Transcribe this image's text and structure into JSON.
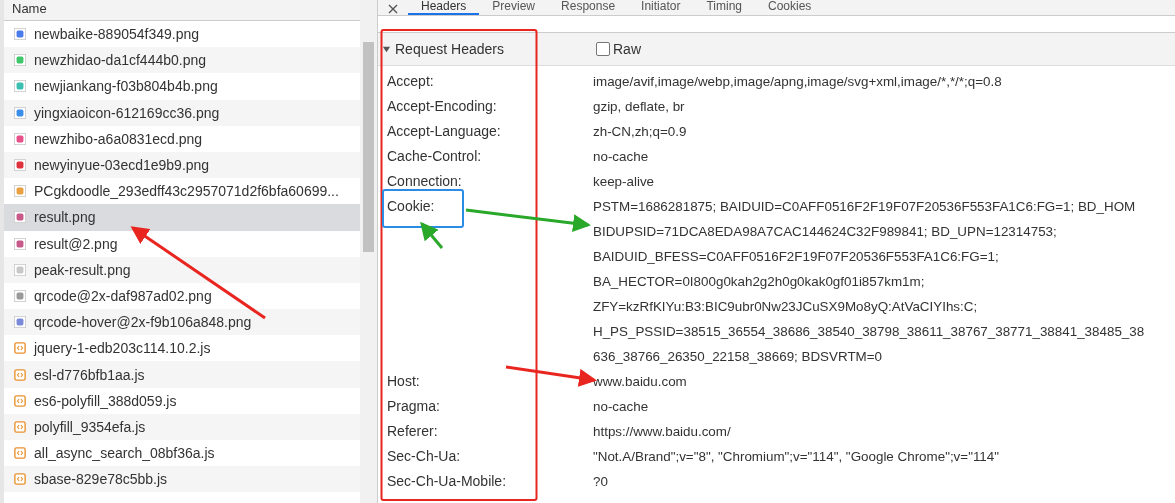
{
  "requests": {
    "column_header": "Name",
    "items": [
      {
        "name": "newbaike-889054f349.png",
        "kind": "image",
        "color": "#4a7bea",
        "selected": false
      },
      {
        "name": "newzhidao-da1cf444b0.png",
        "kind": "image",
        "color": "#3fc56b",
        "selected": false
      },
      {
        "name": "newjiankang-f03b804b4b.png",
        "kind": "image",
        "color": "#3bbfb0",
        "selected": false
      },
      {
        "name": "yingxiaoicon-612169cc36.png",
        "kind": "image",
        "color": "#3a8ee8",
        "selected": false
      },
      {
        "name": "newzhibo-a6a0831ecd.png",
        "kind": "image",
        "color": "#e8508a",
        "selected": false
      },
      {
        "name": "newyinyue-03ecd1e9b9.png",
        "kind": "image",
        "color": "#e0323c",
        "selected": false
      },
      {
        "name": "PCgkdoodle_293edff43c2957071d2f6bfa60699...",
        "kind": "image",
        "color": "#e8a040",
        "selected": false
      },
      {
        "name": "result.png",
        "kind": "image",
        "color": "#c85a8a",
        "selected": true
      },
      {
        "name": "result@2.png",
        "kind": "image",
        "color": "#c85a8a",
        "selected": false
      },
      {
        "name": "peak-result.png",
        "kind": "image",
        "color": "#c8c8c8",
        "selected": false
      },
      {
        "name": "qrcode@2x-daf987ad02.png",
        "kind": "image",
        "color": "#9a9a9a",
        "selected": false
      },
      {
        "name": "qrcode-hover@2x-f9b106a848.png",
        "kind": "image",
        "color": "#7a8ad8",
        "selected": false
      },
      {
        "name": "jquery-1-edb203c114.10.2.js",
        "kind": "script",
        "selected": false
      },
      {
        "name": "esl-d776bfb1aa.js",
        "kind": "script",
        "selected": false
      },
      {
        "name": "es6-polyfill_388d059.js",
        "kind": "script",
        "selected": false
      },
      {
        "name": "polyfill_9354efa.js",
        "kind": "script",
        "selected": false
      },
      {
        "name": "all_async_search_08bf36a.js",
        "kind": "script",
        "selected": false
      },
      {
        "name": "sbase-829e78c5bb.js",
        "kind": "script",
        "selected": false
      }
    ]
  },
  "tabs": [
    {
      "label": "Headers",
      "selected": true
    },
    {
      "label": "Preview",
      "selected": false
    },
    {
      "label": "Response",
      "selected": false
    },
    {
      "label": "Initiator",
      "selected": false
    },
    {
      "label": "Timing",
      "selected": false
    },
    {
      "label": "Cookies",
      "selected": false
    }
  ],
  "request_headers": {
    "title": "Request Headers",
    "expanded": true,
    "raw": {
      "label": "Raw",
      "checked": false
    },
    "rows": [
      {
        "name": "Accept:",
        "value": [
          "image/avif,image/webp,image/apng,image/svg+xml,image/*,*/*;q=0.8"
        ]
      },
      {
        "name": "Accept-Encoding:",
        "value": [
          "gzip, deflate, br"
        ]
      },
      {
        "name": "Accept-Language:",
        "value": [
          "zh-CN,zh;q=0.9"
        ]
      },
      {
        "name": "Cache-Control:",
        "value": [
          "no-cache"
        ]
      },
      {
        "name": "Connection:",
        "value": [
          "keep-alive"
        ]
      },
      {
        "name": "Cookie:",
        "value": [
          "PSTM=1686281875; BAIDUID=C0AFF0516F2F19F07F20536F553FA1C6:FG=1; BD_HOM",
          "BIDUPSID=71DCA8EDA98A7CAC144624C32F989841; BD_UPN=12314753;",
          "BAIDUID_BFESS=C0AFF0516F2F19F07F20536F553FA1C6:FG=1;",
          "BA_HECTOR=0I800g0kah2g2h0g0kak0gf01i857km1m;",
          "ZFY=kzRfKIYu:B3:BIC9ubr0Nw23JCuSX9Mo8yQ:AtVaCIYIhs:C;",
          "H_PS_PSSID=38515_36554_38686_38540_38798_38611_38767_38771_38841_38485_38",
          "636_38766_26350_22158_38669; BDSVRTM=0"
        ]
      },
      {
        "name": "Host:",
        "value": [
          "www.baidu.com"
        ]
      },
      {
        "name": "Pragma:",
        "value": [
          "no-cache"
        ]
      },
      {
        "name": "Referer:",
        "value": [
          "https://www.baidu.com/"
        ]
      },
      {
        "name": "Sec-Ch-Ua:",
        "value": [
          "\"Not.A/Brand\";v=\"8\", \"Chromium\";v=\"114\", \"Google Chrome\";v=\"114\""
        ]
      },
      {
        "name": "Sec-Ch-Ua-Mobile:",
        "value": [
          "?0"
        ]
      }
    ]
  }
}
